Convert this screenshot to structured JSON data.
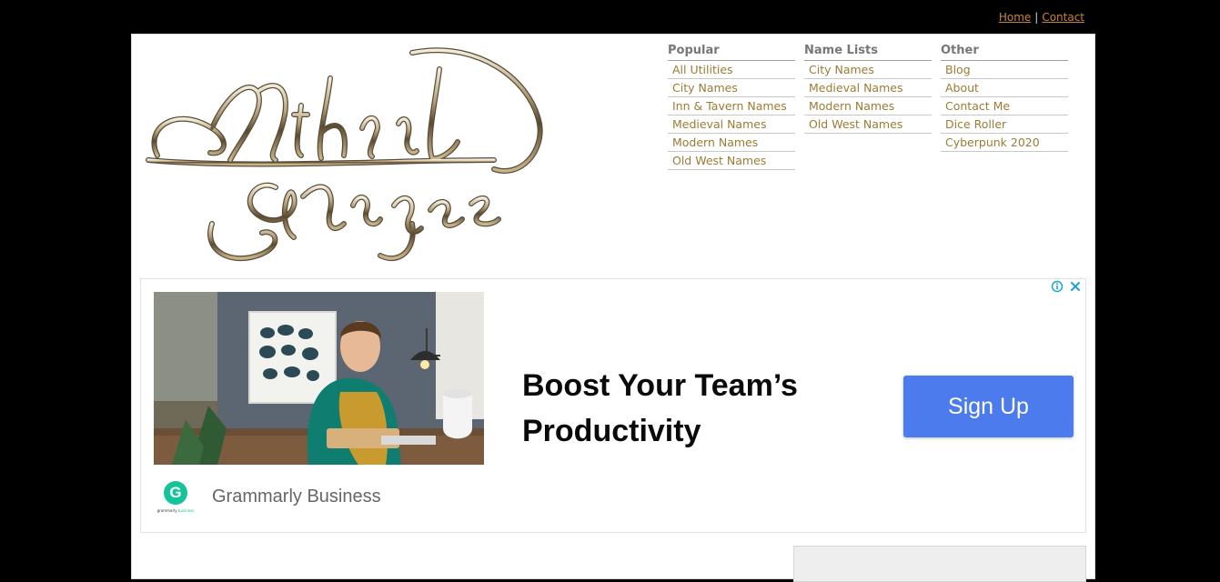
{
  "top_links": {
    "home": "Home",
    "separator": "|",
    "contact": "Contact"
  },
  "logo": {
    "text_line1": "Mithril",
    "text_line2": "Mages"
  },
  "nav": {
    "columns": [
      {
        "heading": "Popular",
        "items": [
          "All Utilities",
          "City Names",
          "Inn & Tavern Names",
          "Medieval Names",
          "Modern Names",
          "Old West Names"
        ]
      },
      {
        "heading": "Name Lists",
        "items": [
          "City Names",
          "Medieval Names",
          "Modern Names",
          "Old West Names"
        ]
      },
      {
        "heading": "Other",
        "items": [
          "Blog",
          "About",
          "Contact Me",
          "Dice Roller",
          "Cyberpunk 2020"
        ]
      }
    ]
  },
  "ad": {
    "headline_line1": "Boost Your Team’s",
    "headline_line2": "Productivity",
    "cta": "Sign Up",
    "advertiser": "Grammarly Business",
    "logo_letter": "G",
    "logo_tiny_word1": "grammarly",
    "logo_tiny_word2": "business",
    "info_icon": "info-icon",
    "close_icon": "close-icon",
    "cta_color": "#4b7bec",
    "brand_color": "#15c39a"
  },
  "colors": {
    "page_background": "#000000",
    "content_background": "#ffffff",
    "link_color": "#9c7b35",
    "top_link_color": "#c9852f",
    "heading_color": "#777777"
  }
}
